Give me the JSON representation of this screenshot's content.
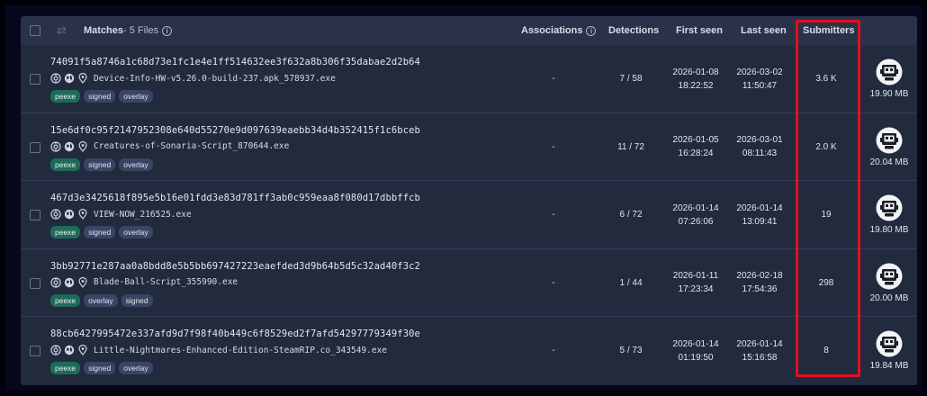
{
  "header": {
    "matches_label": "Matches",
    "matches_count": " - 5 Files",
    "associations": "Associations",
    "detections": "Detections",
    "first_seen": "First seen",
    "last_seen": "Last seen",
    "submitters": "Submitters"
  },
  "rows": [
    {
      "hash": "74091f5a8746a1c68d73e1fc1e4e1ff514632ee3f632a8b306f35dabae2d2b64",
      "filename": "Device-Info-HW-v5.26.0-build-237.apk_578937.exe",
      "tags": [
        "peexe",
        "signed",
        "overlay"
      ],
      "associations": "-",
      "detections": "7 / 58",
      "first_seen_date": "2026-01-08",
      "first_seen_time": "18:22:52",
      "last_seen_date": "2026-03-02",
      "last_seen_time": "11:50:47",
      "submitters": "3.6 K",
      "size": "19.90 MB"
    },
    {
      "hash": "15e6df0c95f2147952308e640d55270e9d097639eaebb34d4b352415f1c6bceb",
      "filename": "Creatures-of-Sonaria-Script_870644.exe",
      "tags": [
        "peexe",
        "signed",
        "overlay"
      ],
      "associations": "-",
      "detections": "11 / 72",
      "first_seen_date": "2026-01-05",
      "first_seen_time": "16:28:24",
      "last_seen_date": "2026-03-01",
      "last_seen_time": "08:11:43",
      "submitters": "2.0 K",
      "size": "20.04 MB"
    },
    {
      "hash": "467d3e3425618f895e5b16e01fdd3e83d781ff3ab0c959eaa8f080d17dbbffcb",
      "filename": "VIEW-NOW_216525.exe",
      "tags": [
        "peexe",
        "signed",
        "overlay"
      ],
      "associations": "-",
      "detections": "6 / 72",
      "first_seen_date": "2026-01-14",
      "first_seen_time": "07:26:06",
      "last_seen_date": "2026-01-14",
      "last_seen_time": "13:09:41",
      "submitters": "19",
      "size": "19.80 MB"
    },
    {
      "hash": "3bb92771e287aa0a8bdd8e5b5bb697427223eaefded3d9b64b5d5c32ad40f3c2",
      "filename": "Blade-Ball-Script_355990.exe",
      "tags": [
        "peexe",
        "overlay",
        "signed"
      ],
      "associations": "-",
      "detections": "1 / 44",
      "first_seen_date": "2026-01-11",
      "first_seen_time": "17:23:34",
      "last_seen_date": "2026-02-18",
      "last_seen_time": "17:54:36",
      "submitters": "298",
      "size": "20.00 MB"
    },
    {
      "hash": "88cb6427995472e337afd9d7f98f40b449c6f8529ed2f7afd54297779349f30e",
      "filename": "Little-Nightmares-Enhanced-Edition-SteamRIP.co_343549.exe",
      "tags": [
        "peexe",
        "signed",
        "overlay"
      ],
      "associations": "-",
      "detections": "5 / 73",
      "first_seen_date": "2026-01-14",
      "first_seen_time": "01:19:50",
      "last_seen_date": "2026-01-14",
      "last_seen_time": "15:16:58",
      "submitters": "8",
      "size": "19.84 MB"
    }
  ],
  "colors": {
    "background": "#22293d",
    "header": "#2a324a",
    "tag_green": "#1f6a5a",
    "tag_default": "#3a4564",
    "highlight": "#e2101b"
  },
  "icons": {
    "file_type": "pe-exe-icon",
    "row_meta": [
      "radar-icon",
      "globe-icon",
      "location-pin-icon"
    ],
    "header_info": "info-icon",
    "header_sort": "sort-arrows-icon"
  }
}
